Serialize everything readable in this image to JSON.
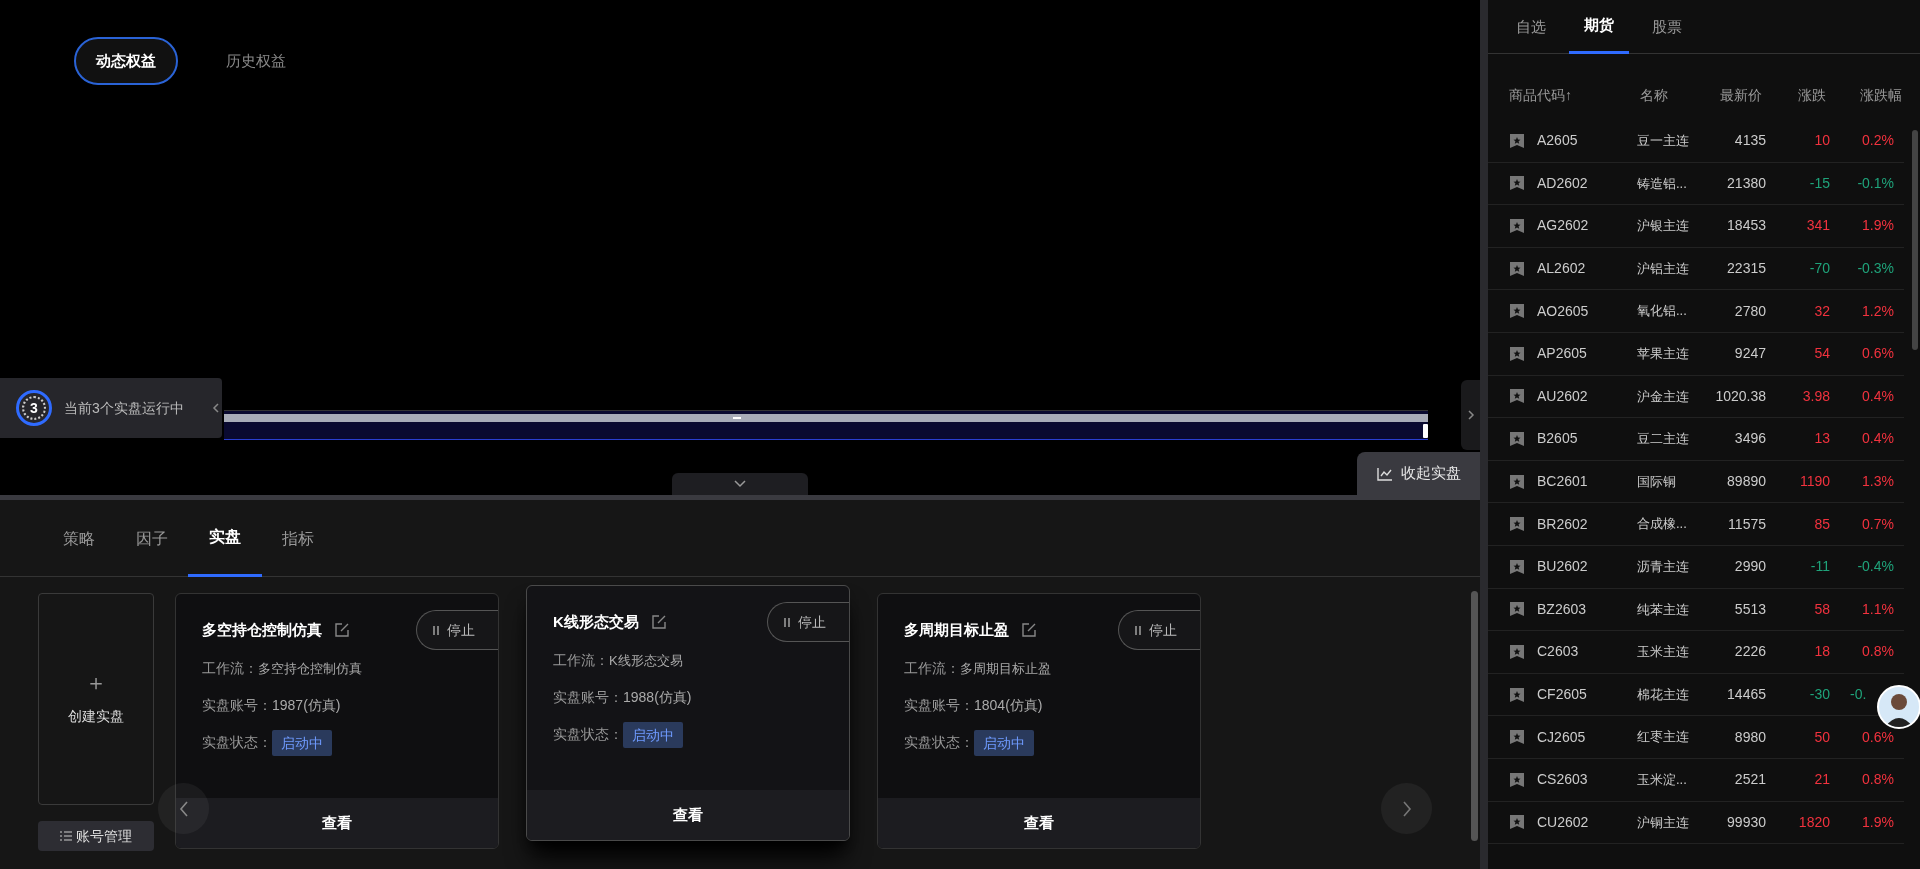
{
  "equity_tabs": [
    {
      "label": "动态权益",
      "selected": true
    },
    {
      "label": "历史权益",
      "selected": false
    }
  ],
  "running": {
    "count": "3",
    "text": "当前3个实盘运行中"
  },
  "range_slider": {
    "level": 1
  },
  "collapse_button": "收起实盘",
  "bottom_tabs": [
    {
      "label": "策略",
      "selected": false
    },
    {
      "label": "因子",
      "selected": false
    },
    {
      "label": "实盘",
      "selected": true
    },
    {
      "label": "指标",
      "selected": false
    }
  ],
  "create_card": {
    "label": "创建实盘",
    "icon": "＋"
  },
  "account_button": "账号管理",
  "cards": [
    {
      "title": "多空持仓控制仿真",
      "stop": "停止",
      "workflow_label": "工作流：",
      "workflow": "多空持仓控制仿真",
      "account_label": "实盘账号：",
      "account": "1987(仿真)",
      "status_label": "实盘状态：",
      "status": "启动中",
      "view": "查看",
      "raised": false
    },
    {
      "title": "K线形态交易",
      "stop": "停止",
      "workflow_label": "工作流：",
      "workflow": "K线形态交易",
      "account_label": "实盘账号：",
      "account": "1988(仿真)",
      "status_label": "实盘状态：",
      "status": "启动中",
      "view": "查看",
      "raised": true
    },
    {
      "title": "多周期目标止盈",
      "stop": "停止",
      "workflow_label": "工作流：",
      "workflow": "多周期目标止盈",
      "account_label": "实盘账号：",
      "account": "1804(仿真)",
      "status_label": "实盘状态：",
      "status": "启动中",
      "view": "查看",
      "raised": false
    }
  ],
  "market_tabs": [
    {
      "label": "自选",
      "selected": false
    },
    {
      "label": "期货",
      "selected": true
    },
    {
      "label": "股票",
      "selected": false
    }
  ],
  "market_table": {
    "columns": [
      "商品代码↑",
      "名称",
      "最新价",
      "涨跌",
      "涨跌幅"
    ],
    "rows": [
      {
        "code": "A2605",
        "name": "豆一主连",
        "price": "4135",
        "change": "10",
        "pct": "0.2%",
        "color": "#f2323e"
      },
      {
        "code": "AD2602",
        "name": "铸造铝...",
        "price": "21380",
        "change": "-15",
        "pct": "-0.1%",
        "color": "#1fa37a"
      },
      {
        "code": "AG2602",
        "name": "沪银主连",
        "price": "18453",
        "change": "341",
        "pct": "1.9%",
        "color": "#f2323e"
      },
      {
        "code": "AL2602",
        "name": "沪铝主连",
        "price": "22315",
        "change": "-70",
        "pct": "-0.3%",
        "color": "#1fa37a"
      },
      {
        "code": "AO2605",
        "name": "氧化铝...",
        "price": "2780",
        "change": "32",
        "pct": "1.2%",
        "color": "#f2323e"
      },
      {
        "code": "AP2605",
        "name": "苹果主连",
        "price": "9247",
        "change": "54",
        "pct": "0.6%",
        "color": "#f2323e"
      },
      {
        "code": "AU2602",
        "name": "沪金主连",
        "price": "1020.38",
        "change": "3.98",
        "pct": "0.4%",
        "color": "#f2323e"
      },
      {
        "code": "B2605",
        "name": "豆二主连",
        "price": "3496",
        "change": "13",
        "pct": "0.4%",
        "color": "#f2323e"
      },
      {
        "code": "BC2601",
        "name": "国际铜",
        "price": "89890",
        "change": "1190",
        "pct": "1.3%",
        "color": "#f2323e"
      },
      {
        "code": "BR2602",
        "name": "合成橡...",
        "price": "11575",
        "change": "85",
        "pct": "0.7%",
        "color": "#f2323e"
      },
      {
        "code": "BU2602",
        "name": "沥青主连",
        "price": "2990",
        "change": "-11",
        "pct": "-0.4%",
        "color": "#1fa37a"
      },
      {
        "code": "BZ2603",
        "name": "纯苯主连",
        "price": "5513",
        "change": "58",
        "pct": "1.1%",
        "color": "#f2323e"
      },
      {
        "code": "C2603",
        "name": "玉米主连",
        "price": "2226",
        "change": "18",
        "pct": "0.8%",
        "color": "#f2323e"
      },
      {
        "code": "CF2605",
        "name": "棉花主连",
        "price": "14465",
        "change": "-30",
        "pct": "-0.",
        "color": "#1fa37a"
      },
      {
        "code": "CJ2605",
        "name": "红枣主连",
        "price": "8980",
        "change": "50",
        "pct": "0.6%",
        "color": "#f2323e"
      },
      {
        "code": "CS2603",
        "name": "玉米淀...",
        "price": "2521",
        "change": "21",
        "pct": "0.8%",
        "color": "#f2323e"
      },
      {
        "code": "CU2602",
        "name": "沪铜主连",
        "price": "99930",
        "change": "1820",
        "pct": "1.9%",
        "color": "#f2323e"
      }
    ]
  }
}
